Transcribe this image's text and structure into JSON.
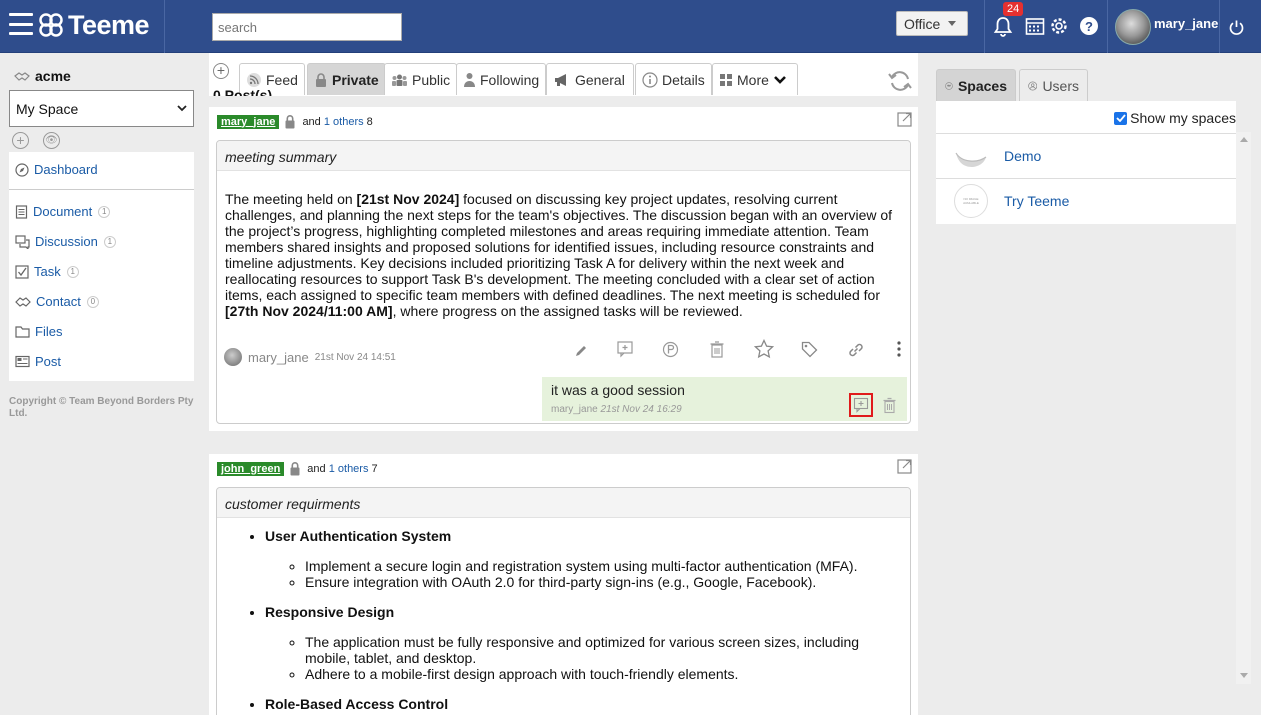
{
  "header": {
    "app_name": "Teeme",
    "search_placeholder": "search",
    "office_label": "Office",
    "notification_count": "24",
    "help_label": "?",
    "username": "mary_jane"
  },
  "sidebar": {
    "org_name": "acme",
    "space_selected": "My Space",
    "items": [
      {
        "label": "Dashboard",
        "icon": "compass-icon",
        "count": ""
      },
      {
        "label": "Document",
        "icon": "document-icon",
        "count": "1"
      },
      {
        "label": "Discussion",
        "icon": "chat-icon",
        "count": "1"
      },
      {
        "label": "Task",
        "icon": "checkbox-icon",
        "count": "1"
      },
      {
        "label": "Contact",
        "icon": "handshake-icon",
        "count": "0"
      },
      {
        "label": "Files",
        "icon": "folder-icon",
        "count": ""
      },
      {
        "label": "Post",
        "icon": "post-icon",
        "count": ""
      }
    ],
    "copyright": "Copyright © Team Beyond Borders Pty Ltd."
  },
  "tabs": {
    "add_label": "+",
    "items": [
      {
        "label": "Feed",
        "icon": "rss-icon",
        "active": false
      },
      {
        "label": "Private",
        "icon": "lock-icon",
        "active": true
      },
      {
        "label": "Public",
        "icon": "group-icon",
        "active": false
      },
      {
        "label": "Following",
        "icon": "person-icon",
        "active": false
      },
      {
        "label": "General",
        "icon": "megaphone-icon",
        "active": false
      },
      {
        "label": "Details",
        "icon": "info-icon",
        "active": false
      },
      {
        "label": "More",
        "icon": "grid-icon",
        "active": false
      }
    ]
  },
  "feed": {
    "title": "0 Post(s)"
  },
  "posts": [
    {
      "user": "mary_jane",
      "and_text": "and",
      "others_link": "1 others",
      "count": "8",
      "title": "meeting summary",
      "body_parts": [
        "The meeting held on ",
        "[21st Nov 2024]",
        " focused on discussing key project updates, resolving current challenges, and planning the next steps for the team's objectives. The discussion began with an overview of the project’s progress, highlighting completed milestones and areas requiring immediate attention. Team members shared insights and proposed solutions for identified issues, including resource constraints and timeline adjustments. Key decisions included prioritizing Task A for delivery within the next week and reallocating resources to support Task B's development. The meeting concluded with a clear set of action items, each assigned to specific team members with defined deadlines. The next meeting is scheduled for ",
        "[27th Nov 2024/11:00 AM]",
        ", where progress on the assigned tasks will be reviewed."
      ],
      "author": "mary_jane",
      "timestamp": "21st Nov 24 14:51",
      "comment": {
        "text": "it was a good session",
        "author": "mary_jane",
        "timestamp": "21st Nov 24 16:29"
      }
    },
    {
      "user": "john_green",
      "and_text": "and",
      "others_link": "1 others",
      "count": "7",
      "title": "customer requirments",
      "sections": [
        {
          "heading": "User Authentication System",
          "points": [
            "Implement a secure login and registration system using multi-factor authentication (MFA).",
            "Ensure integration with OAuth 2.0 for third-party sign-ins (e.g., Google, Facebook)."
          ]
        },
        {
          "heading": "Responsive Design",
          "points": [
            "The application must be fully responsive and optimized for various screen sizes, including mobile, tablet, and desktop.",
            "Adhere to a mobile-first design approach with touch-friendly elements."
          ]
        },
        {
          "heading": "Role-Based Access Control",
          "points": []
        }
      ]
    }
  ],
  "right": {
    "tabs": [
      {
        "label": "Spaces",
        "active": true
      },
      {
        "label": "Users",
        "active": false
      }
    ],
    "show_my_spaces": "Show my spaces",
    "spaces": [
      {
        "name": "Demo"
      },
      {
        "name": "Try Teeme",
        "image_text": "NO IMAGE AVAILABLE"
      }
    ]
  },
  "colors": {
    "header_bg": "#2f4d8c",
    "user_tag": "#2a8a2a",
    "link": "#1a5ba6",
    "highlight": "#e01b1b",
    "comment_bg": "#e6f2dc"
  }
}
